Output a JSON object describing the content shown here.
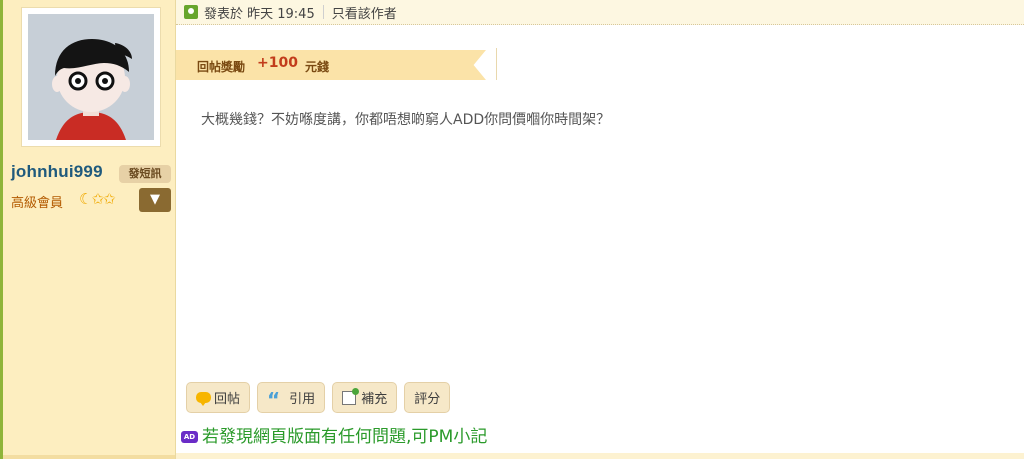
{
  "post": {
    "header": {
      "posted_at": "發表於 昨天 19:45",
      "author_only_link": "只看該作者"
    },
    "reward": {
      "label": "回帖獎勵",
      "value": "+100",
      "unit": "元錢"
    },
    "content": "大概幾錢？不妨喺度講，你都唔想啲窮人ADD你問價嗰你時間架？"
  },
  "user": {
    "username": "johnhui999",
    "pm_button": "發短訊",
    "rank": "高級會員",
    "rank_icons": "☾✩✩",
    "menu_arrow": "▼"
  },
  "actions": {
    "reply": "回帖",
    "quote": "引用",
    "supplement": "補充",
    "rate": "評分"
  },
  "ad": {
    "icon": "AD",
    "text": "若發現網頁版面有任何問題,可PM小記"
  },
  "colors": {
    "sidebar_bg": "#fdeec0",
    "username": "#1f5a7d",
    "reward_value": "#c23c1b",
    "ad_text": "#2a9a2a"
  }
}
